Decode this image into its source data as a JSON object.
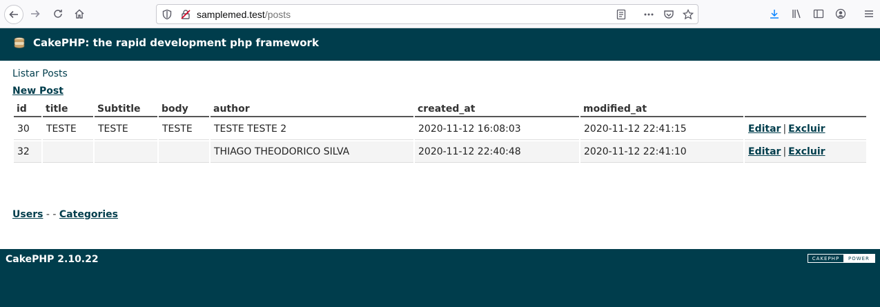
{
  "browser": {
    "url_host": "samplemed.test",
    "url_path": "/posts"
  },
  "header": {
    "title": "CakePHP: the rapid development php framework"
  },
  "page": {
    "heading": "Listar Posts",
    "new_post_label": "New Post"
  },
  "table": {
    "columns": [
      "id",
      "title",
      "Subtitle",
      "body",
      "author",
      "created_at",
      "modified_at",
      ""
    ],
    "rows": [
      {
        "id": "30",
        "title": "TESTE",
        "subtitle": "TESTE",
        "body": "TESTE",
        "author": "TESTE TESTE 2",
        "created_at": "2020-11-12 16:08:03",
        "modified_at": "2020-11-12 22:41:15",
        "edit": "Editar",
        "sep": "|",
        "delete": "Excluir"
      },
      {
        "id": "32",
        "title": "",
        "subtitle": "",
        "body": "",
        "author": "THIAGO THEODORICO SILVA",
        "created_at": "2020-11-12 22:40:48",
        "modified_at": "2020-11-12 22:41:10",
        "edit": "Editar",
        "sep": "|",
        "delete": "Excluir"
      }
    ]
  },
  "nav_links": {
    "users": "Users",
    "separator": "- -",
    "categories": "Categories"
  },
  "footer": {
    "version": "CakePHP 2.10.22",
    "badge_left": "CAKEPHP",
    "badge_right": "POWER"
  },
  "colors": {
    "brand": "#003d4c"
  }
}
